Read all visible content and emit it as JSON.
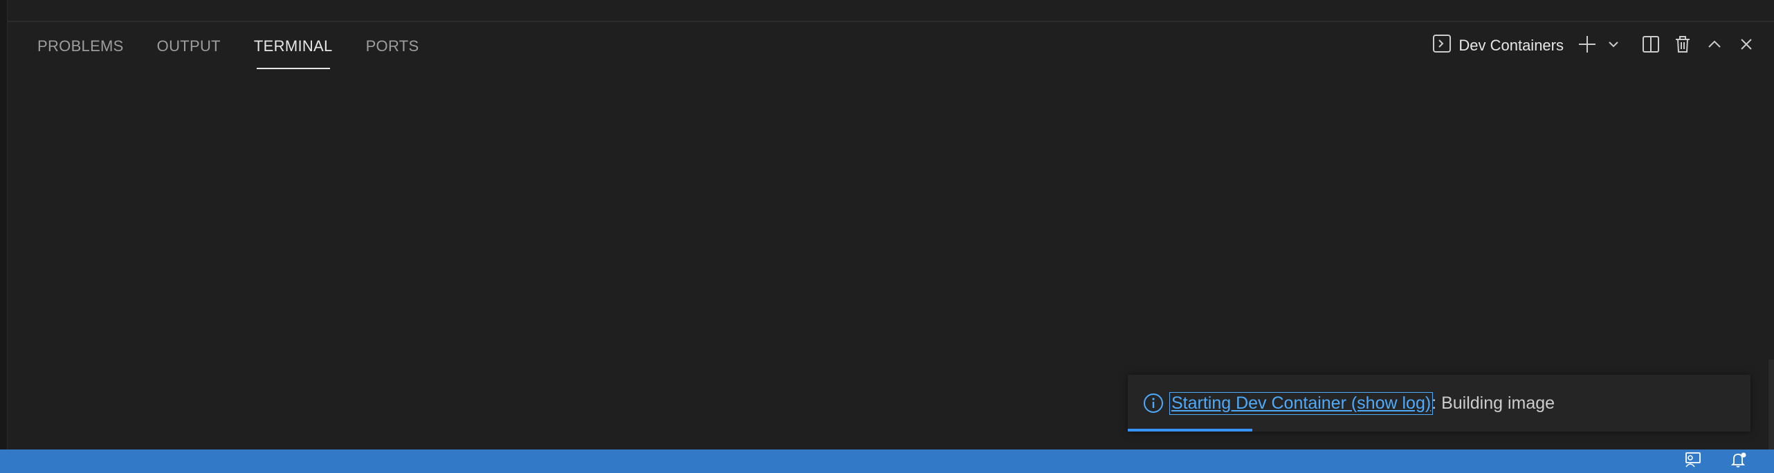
{
  "panel": {
    "tabs": [
      {
        "label": "PROBLEMS"
      },
      {
        "label": "OUTPUT"
      },
      {
        "label": "TERMINAL",
        "active": true
      },
      {
        "label": "PORTS"
      }
    ],
    "active_tab": "TERMINAL"
  },
  "toolbar": {
    "terminal_name": "Dev Containers",
    "icons": [
      "terminal-icon",
      "plus-icon",
      "chevron-down-icon",
      "split-icon",
      "trash-icon",
      "chevron-up-icon",
      "close-icon"
    ]
  },
  "notification": {
    "link_text": "Starting Dev Container (show log)",
    "message": ": Building image",
    "severity": "info"
  },
  "statusbar": {
    "icons": [
      "remote-explorer-icon",
      "bell-notification-icon"
    ]
  },
  "colors": {
    "background": "#1f1f1f",
    "statusbar": "#3279c7",
    "accent_link": "#4daafc",
    "progress": "#3794ff"
  }
}
